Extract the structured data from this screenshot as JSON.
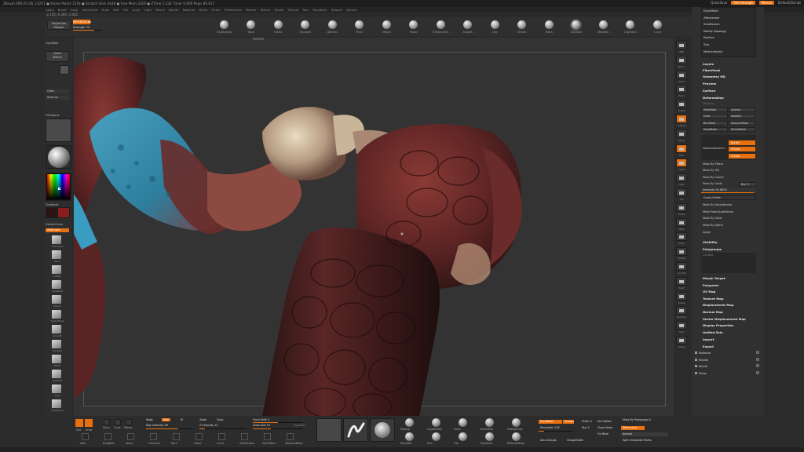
{
  "titlebar": {
    "left": "ZBrush 4R6 P2   QS_14251   ● Active Points 215k  ● Scratch Disk 4448  ● Free Mem 3319  ● ZTime 1.232  Timer 0.059  Polys 85.617",
    "quicksave": "QuickSave",
    "seethrough": "See-through",
    "menus": "Menus",
    "defaultscript": "DefaultZScript"
  },
  "menubar": [
    "Alpha",
    "Brush",
    "Color",
    "Document",
    "Draw",
    "Edit",
    "File",
    "Layer",
    "Light",
    "Macro",
    "Marker",
    "Material",
    "Movie",
    "Picker",
    "Preferences",
    "Render",
    "Stencil",
    "Stroke",
    "Texture",
    "Tool",
    "Transform",
    "Zplugin",
    "Zscript"
  ],
  "coords": "-2.145,-0.385,-3.442",
  "topshelf": {
    "projection": "Projection\nMaster",
    "mrgb": "MRGBZGrab",
    "strength_label": "Strength 75",
    "strength_value": 0.75,
    "brushes": [
      "ClayBuildup",
      "Move",
      "Inflate",
      "Standard",
      "DamStd",
      "Pinch",
      "hPolish",
      "Planar",
      "TrimDynamic",
      "Smooth",
      "Clay",
      "hPolish",
      "Polish",
      "Standard",
      "ZModeler",
      "ClayTubes",
      "Curve"
    ]
  },
  "lefttray": {
    "lightbox": "LightBox",
    "quicksketch": "Quick\nSketch",
    "open": "Open",
    "saveas": "Save As",
    "fillobject": "FillObject",
    "gradient": "Gradient",
    "switchcolor": "SwitchColor",
    "alternate": "Alternate",
    "tools": [
      "Standard",
      "Move",
      "Inflate",
      "ClayBuild",
      "Planar",
      "SnakeHook",
      "Smooth",
      "TrimDyn",
      "Polish",
      "DamStd",
      "Clay",
      "ClayTubes"
    ]
  },
  "rightstrip": [
    "BPR",
    "SPix 3",
    "Scroll",
    "Zoom",
    "Actual",
    "AAHalf",
    "Persp",
    "Floor",
    "Local",
    "LSym",
    "Xyz",
    "Frame",
    "Move",
    "Scale",
    "Rotate",
    "Line Fill",
    "PolyF",
    "Transp",
    "Dynamic",
    "Solo",
    "Xpose"
  ],
  "rightpanel": {
    "head": [
      "DynaMesh",
      "ZRemesher",
      "Subdivision",
      "Modify Topology",
      "Position",
      "Size",
      "MeshIntegrity"
    ],
    "items": {
      "layers": "Layers",
      "fibermesh": "FiberMesh",
      "geohd": "Geometry HD",
      "preview": "Preview",
      "surface": "Surface",
      "deformation": "Deformation",
      "masking": "Masking",
      "view_mask": "ViewMask",
      "inverse": "Inverse",
      "clear": "Clear",
      "mask_all": "MaskAll",
      "blur_mask": "BlurMask",
      "sharpen_mask": "SharpenMask",
      "grow_mask": "GrowMask",
      "shrink_mask": "ShrinkMask",
      "mask_ambient": "MaskAmbientOcc",
      "border": "Border",
      "groups": "Groups",
      "crease": "Crease",
      "mask_fibers": "Mask By Fibers",
      "mask_hd": "Mask By HD",
      "mask_cavity": "Mask By Cavity",
      "mask_cavity2": "Mask By Cavity",
      "blur3": "Blur 3",
      "intensity": "Intensity 94.8653",
      "intensity_value": 0.95,
      "cavity_profile": "Cavity Profile",
      "mask_smooth": "Mask By Smoothness",
      "mask_peaks": "Mask PeaksAndValleys",
      "mask_color": "Mask By Color",
      "mask_alpha": "Mask By Alpha",
      "apply": "Apply",
      "visibility": "Visibility",
      "polygroups": "Polygroups",
      "contact": "Contact",
      "morph_target": "Morph Target",
      "polypaint": "Polypaint",
      "uv_map": "UV Map",
      "texture_map": "Texture Map",
      "displacement_map": "Displacement Map",
      "normal_map": "Normal Map",
      "vector_disp": "Vector Displacement Map",
      "display_props": "Display Properties",
      "unified_skin": "Unified Skin",
      "import": "Import",
      "export": "Export"
    },
    "menus": [
      "Material",
      "Stroke",
      "Movie",
      "Draw"
    ]
  },
  "bottomshelf": {
    "edit": "Edit",
    "draw": "Draw",
    "move": "Move",
    "scale": "Scale",
    "rotate": "Rotate",
    "mrgb": "Mrgb",
    "rgb": "Rgb",
    "m": "M",
    "zadd": "Zadd",
    "zsub": "Zsub",
    "zcut": "Zcut",
    "rgb_intensity": "Rgb Intensity 69",
    "rgb_intensity_value": 0.69,
    "z_intensity": "Z Intensity 12",
    "z_intensity_value": 0.12,
    "focal_shift": "Focal Shift 0",
    "focal_shift_value": 0.5,
    "draw_size": "Draw Size 91",
    "draw_size_value": 0.36,
    "dynamic": "Dynamic",
    "tools": [
      "Dots",
      "DragRect",
      "Spray",
      "Freehand",
      "Rect",
      "Lasso",
      "Curve",
      "SelectLasso",
      "SelectRect",
      "StandardMask"
    ],
    "mats": [
      "MatCap",
      "BasicMat",
      "ClayBuildUp",
      "Skin",
      "Gloss",
      "Flat",
      "BasicMat2",
      "ToyPlastic",
      "MatCapGray",
      "ReflectedMap"
    ],
    "dynamesh": "DynaMesh",
    "resolution": "Resolution 128",
    "resolution_value": 0.16,
    "groups": "Groups",
    "polish": "Polish 0",
    "blur": "Blur 2",
    "del_hidden": "Del Hidden",
    "close_holes": "Close Holes",
    "fix_mesh": "Fix Mesh",
    "zremesher": "ZRemesher",
    "mask_polygroup": "Mask By Polygroups 0",
    "normal": "Normal",
    "split": "Split Unmasked Points",
    "auto_groups": "Auto Groups",
    "group_visible": "GroupVisible"
  },
  "colors": {
    "accent": "#e8700f",
    "bg": "#2b2b2b",
    "canvas": "#333333"
  }
}
